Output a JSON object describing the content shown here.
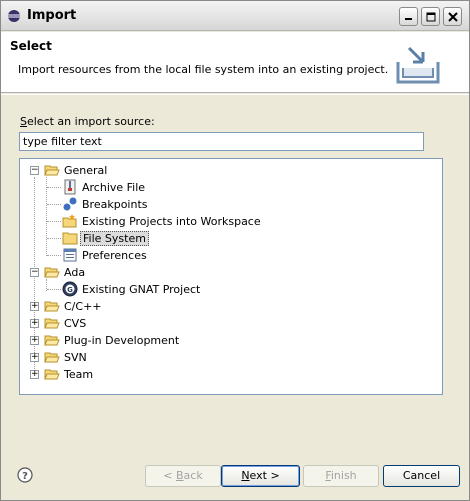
{
  "window": {
    "title": "Import"
  },
  "header": {
    "title": "Select",
    "description": "Import resources from the local file system into an existing project."
  },
  "source": {
    "label_underlined": "S",
    "label_rest": "elect an import source:",
    "filter_value": "type filter text"
  },
  "tree": {
    "items": [
      {
        "label": "General",
        "expanded": true,
        "icon": "folder-icon"
      },
      {
        "label": "Archive File",
        "icon": "archive-file-icon"
      },
      {
        "label": "Breakpoints",
        "icon": "breakpoints-icon"
      },
      {
        "label": "Existing Projects into Workspace",
        "icon": "existing-projects-icon"
      },
      {
        "label": "File System",
        "icon": "folder-icon",
        "selected": true
      },
      {
        "label": "Preferences",
        "icon": "preferences-icon"
      },
      {
        "label": "Ada",
        "expanded": true,
        "icon": "folder-icon"
      },
      {
        "label": "Existing GNAT Project",
        "icon": "gnat-project-icon"
      },
      {
        "label": "C/C++",
        "expanded": false,
        "icon": "folder-icon"
      },
      {
        "label": "CVS",
        "expanded": false,
        "icon": "folder-icon"
      },
      {
        "label": "Plug-in Development",
        "expanded": false,
        "icon": "folder-icon"
      },
      {
        "label": "SVN",
        "expanded": false,
        "icon": "folder-icon"
      },
      {
        "label": "Team",
        "expanded": false,
        "icon": "folder-icon"
      }
    ]
  },
  "buttons": {
    "back_mnemonic": "B",
    "back_prefix": "< ",
    "back_rest": "ack",
    "next_mnemonic": "N",
    "next_rest": "ext >",
    "finish_mnemonic": "F",
    "finish_rest": "inish",
    "cancel": "Cancel"
  },
  "colors": {
    "selection": "#dcdcdc",
    "folder": "#f5d77a",
    "border": "#7f9db9"
  }
}
